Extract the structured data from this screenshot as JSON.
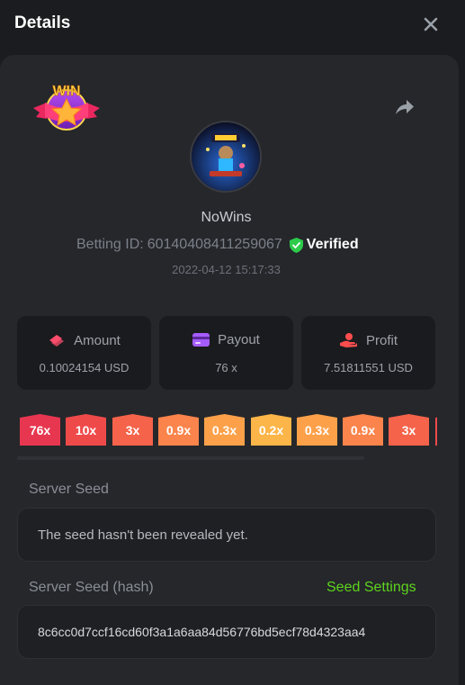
{
  "header": {
    "title": "Details"
  },
  "bet": {
    "username": "NoWins",
    "betting_label": "Betting ID:",
    "betting_id": "60140408411259067",
    "verified_label": "Verified",
    "timestamp": "2022-04-12 15:17:33",
    "badge_text": "WIN"
  },
  "stats": [
    {
      "label": "Amount",
      "value": "0.10024154 USD",
      "icon": "wallet-icon",
      "color": "#ff4d6d"
    },
    {
      "label": "Payout",
      "value": "76 x",
      "icon": "card-icon",
      "color": "#a55cff"
    },
    {
      "label": "Profit",
      "value": "7.51811551 USD",
      "icon": "hand-coin-icon",
      "color": "#ff4d4d"
    }
  ],
  "multipliers": [
    {
      "label": "76x",
      "color": "#e7364f"
    },
    {
      "label": "10x",
      "color": "#ef4a4a"
    },
    {
      "label": "3x",
      "color": "#f5634a"
    },
    {
      "label": "0.9x",
      "color": "#fa844b"
    },
    {
      "label": "0.3x",
      "color": "#fca14a"
    },
    {
      "label": "0.2x",
      "color": "#fcb548"
    },
    {
      "label": "0.3x",
      "color": "#fca14a"
    },
    {
      "label": "0.9x",
      "color": "#fa844b"
    },
    {
      "label": "3x",
      "color": "#f5634a"
    },
    {
      "label": "",
      "color": "#ef4a4a"
    }
  ],
  "server_seed": {
    "label": "Server Seed",
    "value": "The seed hasn't been revealed yet."
  },
  "server_seed_hash": {
    "label": "Server Seed (hash)",
    "settings_label": "Seed Settings",
    "value": "8c6cc0d7ccf16cd60f3a1a6aa84d56776bd5ecf78d4323aa4"
  },
  "colors": {
    "accent_green": "#5ed41d",
    "verified_green": "#2ccb4a"
  }
}
